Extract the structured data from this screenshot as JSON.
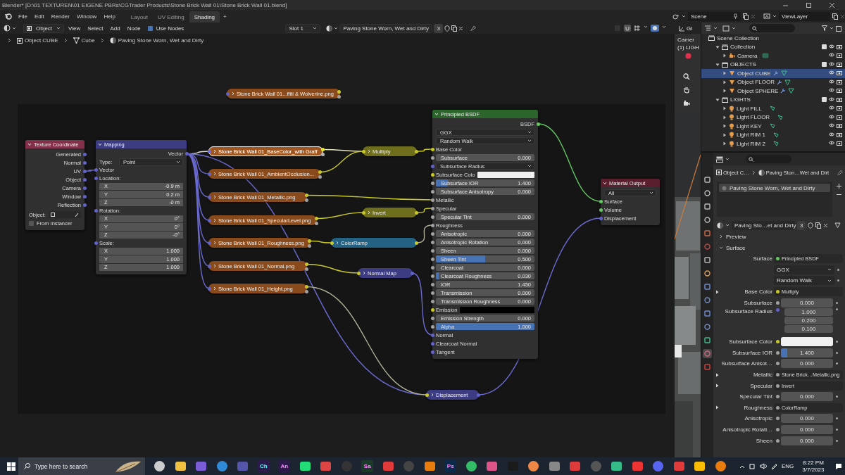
{
  "window": {
    "title": "Blender* [D:\\01 TEXTUREN\\01 EIGENE PBRs\\CGTrader Products\\Stone Brick Wall 01\\Stone Brick Wall 01.blend]"
  },
  "menu": [
    "File",
    "Edit",
    "Render",
    "Window",
    "Help"
  ],
  "workspaces": [
    {
      "label": "Layout",
      "selected": false
    },
    {
      "label": "UV Editing",
      "selected": false
    },
    {
      "label": "Shading",
      "selected": true
    }
  ],
  "add_workspace": "+",
  "scene": "Scene",
  "view_layer": "ViewLayer",
  "node_header": {
    "mode": "Object",
    "menus": [
      "View",
      "Select",
      "Add",
      "Node"
    ],
    "use_nodes": {
      "label": "Use Nodes",
      "checked": true
    },
    "slot": "Slot 1",
    "material": "Paving Stone Worn, Wet and Dirty",
    "users": "3"
  },
  "breadcrumb": [
    "Object CUBE",
    "Cube",
    "Paving Stone Worn, Wet and Dirty"
  ],
  "nodes": {
    "texture_coordinate": {
      "title": "Texture Coordinate",
      "kind": "input",
      "outputs": [
        "Generated",
        "Normal",
        "UV",
        "Object",
        "Camera",
        "Window",
        "Reflection"
      ],
      "object_label": "Object:",
      "from_instancer": {
        "label": "From Instancer",
        "checked": false
      }
    },
    "mapping": {
      "title": "Mapping",
      "kind": "vector",
      "output": "Vector",
      "type_label": "Type:",
      "type": "Point",
      "input": "Vector",
      "groups": [
        {
          "label": "Location:",
          "fields": [
            {
              "axis": "X",
              "value": "-0.9 m"
            },
            {
              "axis": "Y",
              "value": "0.2 m"
            },
            {
              "axis": "Z",
              "value": "-0 m"
            }
          ]
        },
        {
          "label": "Rotation:",
          "fields": [
            {
              "axis": "X",
              "value": "0°"
            },
            {
              "axis": "Y",
              "value": "0°"
            },
            {
              "axis": "Z",
              "value": "-0°"
            }
          ]
        },
        {
          "label": "Scale:",
          "fields": [
            {
              "axis": "X",
              "value": "1.000"
            },
            {
              "axis": "Y",
              "value": "1.000"
            },
            {
              "axis": "Z",
              "value": "1.000"
            }
          ]
        }
      ]
    },
    "image_textures": [
      {
        "label": "Stone Brick Wall 01...ffiti & Wolverine.png",
        "selected": false
      },
      {
        "label": "Stone Brick Wall 01_BaseColor_with Graff",
        "selected": true
      },
      {
        "label": "Stone Brick Wall 01_AmbientOcclusion...",
        "selected": false
      },
      {
        "label": "Stone Brick Wall 01_Metallic.png",
        "selected": false
      },
      {
        "label": "Stone Brick Wall 01_SpecularLevel.png",
        "selected": false
      },
      {
        "label": "Stone Brick Wall 01_Roughness.png",
        "selected": false
      },
      {
        "label": "Stone Brick Wall 01_Normal.png",
        "selected": false
      },
      {
        "label": "Stone Brick Wall 01_Height.png",
        "selected": false
      }
    ],
    "collapsed_nodes": [
      {
        "title": "Multiply",
        "kind": "color"
      },
      {
        "title": "Invert",
        "kind": "color"
      },
      {
        "title": "ColorRamp",
        "kind": "converter"
      },
      {
        "title": "Normal Map",
        "kind": "vector"
      },
      {
        "title": "Displacement",
        "kind": "vector"
      }
    ],
    "principled_bsdf": {
      "title": "Principled BSDF",
      "kind": "shader",
      "rows": [
        {
          "kind": "output",
          "label": "BSDF",
          "color": "#63c763"
        },
        {
          "kind": "dropdown",
          "value": "GGX"
        },
        {
          "kind": "dropdown",
          "value": "Random Walk"
        },
        {
          "kind": "input",
          "label": "Base Color",
          "color": "#c7c729"
        },
        {
          "kind": "value",
          "label": "Subsurface",
          "value": "0.000",
          "color": "#a1a1a1"
        },
        {
          "kind": "menu",
          "label": "Subsurface Radius",
          "color": "#6363c7"
        },
        {
          "kind": "color",
          "label": "Subsurface Colo",
          "color": "#f0f0f0"
        },
        {
          "kind": "value",
          "label": "Subsurface IOR",
          "value": "1.400",
          "level": 0.12,
          "color": "#a1a1a1"
        },
        {
          "kind": "value",
          "label": "Subsurface Anisotropy",
          "value": "0.000",
          "color": "#a1a1a1"
        },
        {
          "kind": "input",
          "label": "Metallic",
          "color": "#a1a1a1"
        },
        {
          "kind": "input",
          "label": "Specular",
          "color": "#a1a1a1"
        },
        {
          "kind": "value",
          "label": "Specular Tint",
          "value": "0.000",
          "color": "#a1a1a1"
        },
        {
          "kind": "input",
          "label": "Roughness",
          "color": "#a1a1a1"
        },
        {
          "kind": "value",
          "label": "Anisotropic",
          "value": "0.000",
          "color": "#a1a1a1"
        },
        {
          "kind": "value",
          "label": "Anisotropic Rotation",
          "value": "0.000",
          "color": "#a1a1a1"
        },
        {
          "kind": "value",
          "label": "Sheen",
          "value": "0.000",
          "color": "#a1a1a1"
        },
        {
          "kind": "value",
          "label": "Sheen Tint",
          "value": "0.500",
          "level": 0.5,
          "color": "#a1a1a1"
        },
        {
          "kind": "value",
          "label": "Clearcoat",
          "value": "0.000",
          "color": "#a1a1a1"
        },
        {
          "kind": "value",
          "label": "Clearcoat Roughness",
          "value": "0.030",
          "level": 0.03,
          "color": "#a1a1a1"
        },
        {
          "kind": "value",
          "label": "IOR",
          "value": "1.450",
          "color": "#a1a1a1"
        },
        {
          "kind": "value",
          "label": "Transmission",
          "value": "0.000",
          "color": "#a1a1a1"
        },
        {
          "kind": "value",
          "label": "Transmission Roughness",
          "value": "0.000",
          "color": "#a1a1a1"
        },
        {
          "kind": "color",
          "label": "Emission",
          "color": "#000000"
        },
        {
          "kind": "value",
          "label": "Emission Strength",
          "value": "0.000",
          "color": "#a1a1a1"
        },
        {
          "kind": "value",
          "label": "Alpha",
          "value": "1.000",
          "level": 1,
          "color": "#a1a1a1"
        },
        {
          "kind": "input",
          "label": "Normal",
          "color": "#6363c7"
        },
        {
          "kind": "input",
          "label": "Clearcoat Normal",
          "color": "#6363c7"
        },
        {
          "kind": "input",
          "label": "Tangent",
          "color": "#6363c7"
        }
      ]
    },
    "material_output": {
      "title": "Material Output",
      "kind": "output",
      "target": "All",
      "inputs": [
        {
          "label": "Surface",
          "color": "#63c763"
        },
        {
          "label": "Volume",
          "color": "#63c763"
        },
        {
          "label": "Displacement",
          "color": "#6363c7"
        }
      ]
    }
  },
  "viewport": {
    "header_label": "Gl",
    "overlay_lines": [
      "Camer",
      "(1) LIGH"
    ]
  },
  "outliner": {
    "root": "Scene Collection",
    "items": [
      {
        "label": "Collection",
        "kind": "collection",
        "expanded": true,
        "checked": true,
        "selected": false,
        "children": [
          {
            "label": "Camera",
            "kind": "camera",
            "expanded": false,
            "selected": false
          }
        ]
      },
      {
        "label": "OBJECTS",
        "kind": "collection",
        "expanded": true,
        "checked": true,
        "selected": false,
        "children": [
          {
            "label": "Object CUBE",
            "kind": "mesh",
            "expanded": false,
            "selected": true
          },
          {
            "label": "Object FLOOR",
            "kind": "mesh",
            "expanded": false,
            "selected": false
          },
          {
            "label": "Object SPHERE",
            "kind": "mesh",
            "expanded": false,
            "selected": false
          }
        ]
      },
      {
        "label": "LIGHTS",
        "kind": "collection",
        "expanded": true,
        "checked": true,
        "selected": false,
        "children": [
          {
            "label": "Light FILL",
            "kind": "light",
            "expanded": false,
            "selected": false
          },
          {
            "label": "Light FLOOR",
            "kind": "light",
            "expanded": false,
            "selected": false
          },
          {
            "label": "Light KEY",
            "kind": "light",
            "expanded": false,
            "selected": false
          },
          {
            "label": "Light RIM 1",
            "kind": "light",
            "expanded": false,
            "selected": false
          },
          {
            "label": "Light RIM 2",
            "kind": "light",
            "expanded": false,
            "selected": false
          }
        ]
      }
    ]
  },
  "properties": {
    "tabs": [
      {
        "selected": false
      },
      {
        "selected": false
      },
      {
        "selected": false
      },
      {
        "selected": false
      },
      {
        "selected": false
      },
      {
        "selected": false
      },
      {
        "selected": false
      },
      {
        "selected": false
      },
      {
        "selected": false
      },
      {
        "selected": false
      },
      {
        "selected": false
      },
      {
        "selected": false
      },
      {
        "selected": false
      },
      {
        "selected": true
      },
      {
        "selected": false
      }
    ],
    "breadcrumb": [
      "Object C…",
      "Paving Ston…Wet and Dirt"
    ],
    "slots": [
      {
        "label": "Paving Stone Worn, Wet and Dirty",
        "selected": true
      }
    ],
    "material": "Paving Sto…et and Dirty",
    "users": "3",
    "panels": [
      {
        "label": "Preview",
        "expanded": false
      },
      {
        "label": "Surface",
        "expanded": true
      }
    ],
    "rows": [
      {
        "kind": "link",
        "label": "Surface",
        "value": "Principled BSDF",
        "color": "#63c763"
      },
      {
        "kind": "dropdown",
        "value": "GGX"
      },
      {
        "kind": "dropdown",
        "value": "Random Walk"
      },
      {
        "kind": "link",
        "label": "Base Color",
        "value": "Multiply",
        "color": "#c7c729",
        "expandable": true
      },
      {
        "kind": "value",
        "label": "Subsurface",
        "value": "0.000",
        "color": "#a1a1a1"
      },
      {
        "kind": "vector",
        "label": "Subsurface Radius",
        "values": [
          "1.000",
          "0.200",
          "0.100"
        ],
        "color": "#6363c7"
      },
      {
        "kind": "color",
        "label": "Subsurface Color",
        "color": "#f0f0f0"
      },
      {
        "kind": "value",
        "label": "Subsurface IOR",
        "value": "1.400",
        "level": 0.12,
        "color": "#a1a1a1"
      },
      {
        "kind": "value",
        "label": "Subsurface Anisot…",
        "value": "0.000",
        "color": "#a1a1a1"
      },
      {
        "kind": "link",
        "label": "Metallic",
        "value": "Stone Brick…Metallic.png",
        "color": "#a1a1a1",
        "expandable": true
      },
      {
        "kind": "link",
        "label": "Specular",
        "value": "Invert",
        "color": "#a1a1a1",
        "expandable": true
      },
      {
        "kind": "value",
        "label": "Specular Tint",
        "value": "0.000",
        "color": "#a1a1a1"
      },
      {
        "kind": "link",
        "label": "Roughness",
        "value": "ColorRamp",
        "color": "#a1a1a1",
        "expandable": true
      },
      {
        "kind": "value",
        "label": "Anisotropic",
        "value": "0.000",
        "color": "#a1a1a1"
      },
      {
        "kind": "value",
        "label": "Anisotropic Rotati…",
        "value": "0.000",
        "color": "#a1a1a1"
      },
      {
        "kind": "value",
        "label": "Sheen",
        "value": "0.000",
        "color": "#a1a1a1"
      }
    ]
  },
  "taskbar": {
    "search": {
      "placeholder": "Type here to search"
    },
    "apps": [
      {
        "kind": "glyph"
      },
      {
        "kind": "glyph"
      },
      {
        "kind": "glyph"
      },
      {
        "kind": "glyph"
      },
      {
        "kind": "glyph"
      },
      {
        "kind": "text",
        "label": "Ch"
      },
      {
        "kind": "text",
        "label": "An"
      },
      {
        "kind": "glyph"
      },
      {
        "kind": "glyph"
      },
      {
        "kind": "glyph"
      },
      {
        "kind": "text",
        "label": "Sa"
      },
      {
        "kind": "glyph"
      },
      {
        "kind": "glyph"
      },
      {
        "kind": "glyph"
      },
      {
        "kind": "text",
        "label": "Ps"
      },
      {
        "kind": "glyph"
      },
      {
        "kind": "glyph"
      },
      {
        "kind": "glyph"
      },
      {
        "kind": "glyph"
      },
      {
        "kind": "glyph"
      },
      {
        "kind": "glyph"
      },
      {
        "kind": "glyph"
      },
      {
        "kind": "glyph"
      },
      {
        "kind": "glyph"
      },
      {
        "kind": "glyph"
      },
      {
        "kind": "glyph"
      },
      {
        "kind": "glyph"
      },
      {
        "kind": "glyph"
      }
    ],
    "language": "ENG",
    "time": "8:22 PM",
    "date": "3/7/2023"
  }
}
